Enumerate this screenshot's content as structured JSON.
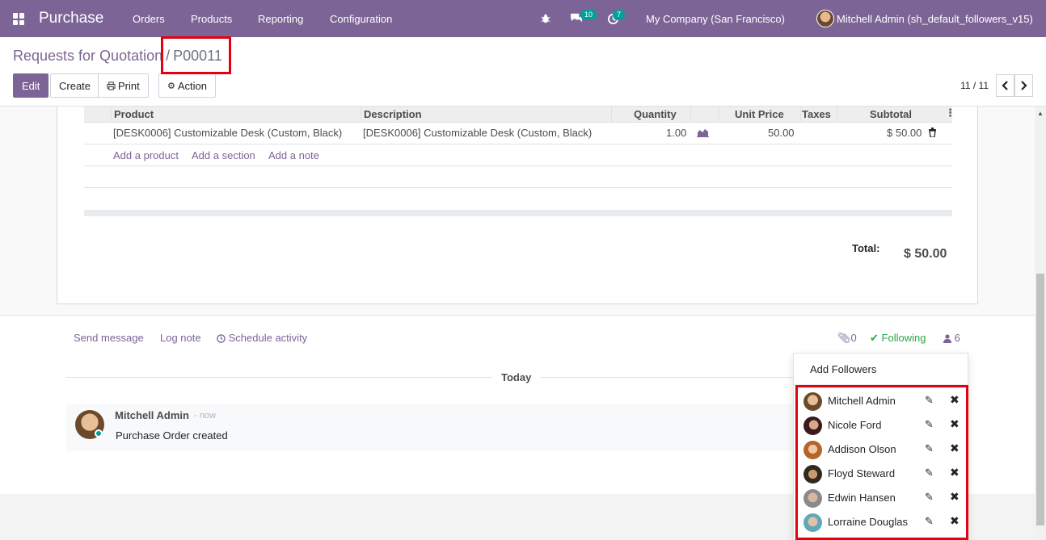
{
  "navbar": {
    "brand": "Purchase",
    "menu": [
      "Orders",
      "Products",
      "Reporting",
      "Configuration"
    ],
    "messages_count": "10",
    "activities_count": "7",
    "company": "My Company (San Francisco)",
    "user": "Mitchell Admin (sh_default_followers_v15)"
  },
  "breadcrumb": {
    "parent": "Requests for Quotation",
    "separator": "/",
    "current": "P00011"
  },
  "toolbar": {
    "edit_label": "Edit",
    "create_label": "Create",
    "print_label": "Print",
    "action_label": "Action",
    "pager": "11 / 11"
  },
  "order_lines": {
    "columns": [
      "Product",
      "Description",
      "Quantity",
      "Unit Price",
      "Taxes",
      "Subtotal"
    ],
    "rows": [
      {
        "product": "[DESK0006] Customizable Desk (Custom, Black)",
        "description": "[DESK0006] Customizable Desk (Custom, Black)",
        "quantity": "1.00",
        "unit_price": "50.00",
        "taxes": "",
        "subtotal": "$ 50.00"
      }
    ],
    "add_product": "Add a product",
    "add_section": "Add a section",
    "add_note": "Add a note",
    "total_label": "Total:",
    "total_value": "$ 50.00"
  },
  "chatter": {
    "send_message": "Send message",
    "log_note": "Log note",
    "schedule_activity": "Schedule activity",
    "attachments_count": "0",
    "following_label": "Following",
    "followers_count": "6",
    "date_separator": "Today",
    "messages": [
      {
        "author": "Mitchell Admin",
        "date": "- now",
        "body": "Purchase Order created"
      }
    ]
  },
  "followers_dropdown": {
    "add_label": "Add Followers",
    "followers": [
      {
        "name": "Mitchell Admin",
        "avatar_color": "#6b4a2b"
      },
      {
        "name": "Nicole Ford",
        "avatar_color": "#5a2a2a"
      },
      {
        "name": "Addison Olson",
        "avatar_color": "#b5652b"
      },
      {
        "name": "Floyd Steward",
        "avatar_color": "#2f2a20"
      },
      {
        "name": "Edwin Hansen",
        "avatar_color": "#8a8a8a"
      },
      {
        "name": "Lorraine Douglas",
        "avatar_color": "#5fa8b8"
      }
    ]
  },
  "colors": {
    "brand": "#7c6596",
    "following": "#28a745",
    "highlight": "#e3000f"
  }
}
